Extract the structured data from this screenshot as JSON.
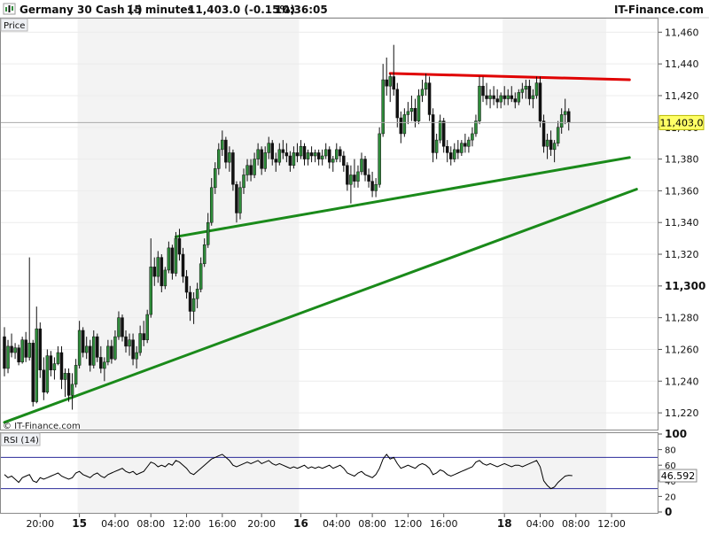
{
  "header": {
    "instrument": "Germany 30 Cash (-)",
    "timeframe": "15 minutes",
    "last_change": "11,403.0 (-0.15%)",
    "time": "10:36:05",
    "brand": "IT-Finance.com"
  },
  "price_panel": {
    "label": "Price",
    "watermark": "© IT-Finance.com"
  },
  "rsi_panel": {
    "label": "RSI (14)"
  },
  "colors": {
    "up_candle": "#2e8b3a",
    "down_candle": "#111111",
    "support_line": "#1a8a1a",
    "resistance_line": "#e00000",
    "rsi_line": "#000000",
    "rsi_bands": "#2b2b99",
    "price_tag_bg": "#ffff66"
  },
  "chart_data": [
    {
      "type": "candlestick",
      "y_ticks": [
        "11,220",
        "11,240",
        "11,260",
        "11,280",
        "11,300",
        "11,320",
        "11,340",
        "11,360",
        "11,380",
        "11,400",
        "11,420",
        "11,440",
        "11,460"
      ],
      "y_tick_values": [
        11220,
        11240,
        11260,
        11280,
        11300,
        11320,
        11340,
        11360,
        11380,
        11400,
        11420,
        11440,
        11460
      ],
      "y_major_tick": 11300,
      "ylim": [
        11210,
        11468
      ],
      "x_ticks": [
        "20:00",
        "15",
        "04:00",
        "08:00",
        "12:00",
        "16:00",
        "20:00",
        "16",
        "04:00",
        "08:00",
        "12:00",
        "16:00",
        "18",
        "04:00",
        "08:00",
        "12:00"
      ],
      "x_tick_index": [
        10,
        21,
        31,
        41,
        51,
        61,
        72,
        83,
        93,
        103,
        113,
        123,
        140,
        150,
        160,
        170
      ],
      "day_separators": [
        21,
        83,
        140
      ],
      "last_price": 11403.0,
      "last_price_label": "11,403,0",
      "candles": [
        [
          11268,
          11274,
          11243,
          11248
        ],
        [
          11248,
          11266,
          11245,
          11262
        ],
        [
          11262,
          11270,
          11255,
          11258
        ],
        [
          11258,
          11264,
          11254,
          11261
        ],
        [
          11261,
          11263,
          11250,
          11252
        ],
        [
          11252,
          11268,
          11251,
          11266
        ],
        [
          11266,
          11271,
          11252,
          11255
        ],
        [
          11255,
          11318,
          11253,
          11264
        ],
        [
          11264,
          11266,
          11224,
          11227
        ],
        [
          11227,
          11287,
          11226,
          11273
        ],
        [
          11273,
          11277,
          11242,
          11247
        ],
        [
          11247,
          11255,
          11228,
          11233
        ],
        [
          11233,
          11260,
          11232,
          11256
        ],
        [
          11256,
          11259,
          11243,
          11247
        ],
        [
          11247,
          11255,
          11241,
          11251
        ],
        [
          11251,
          11262,
          11250,
          11258
        ],
        [
          11258,
          11262,
          11235,
          11241
        ],
        [
          11241,
          11248,
          11230,
          11245
        ],
        [
          11245,
          11248,
          11227,
          11231
        ],
        [
          11231,
          11245,
          11222,
          11238
        ],
        [
          11238,
          11254,
          11236,
          11250
        ],
        [
          11250,
          11278,
          11248,
          11272
        ],
        [
          11272,
          11274,
          11255,
          11258
        ],
        [
          11258,
          11268,
          11254,
          11262
        ],
        [
          11262,
          11266,
          11246,
          11250
        ],
        [
          11250,
          11272,
          11248,
          11268
        ],
        [
          11268,
          11270,
          11252,
          11255
        ],
        [
          11255,
          11262,
          11245,
          11248
        ],
        [
          11248,
          11255,
          11240,
          11252
        ],
        [
          11252,
          11266,
          11250,
          11262
        ],
        [
          11262,
          11266,
          11251,
          11254
        ],
        [
          11254,
          11272,
          11253,
          11268
        ],
        [
          11268,
          11284,
          11266,
          11280
        ],
        [
          11280,
          11282,
          11265,
          11268
        ],
        [
          11268,
          11272,
          11258,
          11262
        ],
        [
          11262,
          11270,
          11256,
          11266
        ],
        [
          11266,
          11270,
          11250,
          11254
        ],
        [
          11254,
          11262,
          11248,
          11258
        ],
        [
          11258,
          11275,
          11256,
          11270
        ],
        [
          11270,
          11278,
          11262,
          11266
        ],
        [
          11266,
          11285,
          11264,
          11282
        ],
        [
          11282,
          11330,
          11280,
          11312
        ],
        [
          11312,
          11318,
          11300,
          11306
        ],
        [
          11306,
          11322,
          11302,
          11318
        ],
        [
          11318,
          11320,
          11296,
          11300
        ],
        [
          11300,
          11312,
          11298,
          11310
        ],
        [
          11310,
          11328,
          11308,
          11324
        ],
        [
          11324,
          11326,
          11304,
          11308
        ],
        [
          11308,
          11334,
          11306,
          11330
        ],
        [
          11330,
          11336,
          11316,
          11320
        ],
        [
          11320,
          11324,
          11302,
          11306
        ],
        [
          11306,
          11310,
          11292,
          11296
        ],
        [
          11296,
          11300,
          11278,
          11284
        ],
        [
          11284,
          11296,
          11276,
          11292
        ],
        [
          11292,
          11302,
          11286,
          11298
        ],
        [
          11298,
          11318,
          11296,
          11314
        ],
        [
          11314,
          11330,
          11312,
          11326
        ],
        [
          11326,
          11346,
          11324,
          11340
        ],
        [
          11340,
          11368,
          11338,
          11362
        ],
        [
          11362,
          11378,
          11358,
          11374
        ],
        [
          11374,
          11390,
          11370,
          11386
        ],
        [
          11386,
          11398,
          11382,
          11392
        ],
        [
          11392,
          11394,
          11374,
          11378
        ],
        [
          11378,
          11388,
          11372,
          11384
        ],
        [
          11384,
          11386,
          11360,
          11364
        ],
        [
          11364,
          11366,
          11340,
          11346
        ],
        [
          11346,
          11366,
          11342,
          11362
        ],
        [
          11362,
          11374,
          11358,
          11370
        ],
        [
          11370,
          11380,
          11366,
          11376
        ],
        [
          11376,
          11380,
          11366,
          11370
        ],
        [
          11370,
          11384,
          11368,
          11380
        ],
        [
          11380,
          11390,
          11376,
          11386
        ],
        [
          11386,
          11388,
          11370,
          11374
        ],
        [
          11374,
          11388,
          11372,
          11384
        ],
        [
          11384,
          11394,
          11380,
          11390
        ],
        [
          11390,
          11392,
          11376,
          11380
        ],
        [
          11380,
          11384,
          11372,
          11378
        ],
        [
          11378,
          11390,
          11376,
          11386
        ],
        [
          11386,
          11392,
          11380,
          11384
        ],
        [
          11384,
          11390,
          11378,
          11382
        ],
        [
          11382,
          11385,
          11372,
          11376
        ],
        [
          11376,
          11388,
          11374,
          11384
        ],
        [
          11384,
          11390,
          11378,
          11382
        ],
        [
          11382,
          11392,
          11380,
          11388
        ],
        [
          11388,
          11390,
          11376,
          11380
        ],
        [
          11380,
          11386,
          11376,
          11384
        ],
        [
          11384,
          11388,
          11378,
          11382
        ],
        [
          11382,
          11386,
          11378,
          11384
        ],
        [
          11384,
          11386,
          11376,
          11380
        ],
        [
          11380,
          11386,
          11376,
          11382
        ],
        [
          11382,
          11390,
          11380,
          11386
        ],
        [
          11386,
          11388,
          11374,
          11378
        ],
        [
          11378,
          11382,
          11372,
          11380
        ],
        [
          11380,
          11390,
          11378,
          11386
        ],
        [
          11386,
          11388,
          11378,
          11382
        ],
        [
          11382,
          11385,
          11372,
          11376
        ],
        [
          11376,
          11378,
          11360,
          11364
        ],
        [
          11364,
          11376,
          11352,
          11370
        ],
        [
          11370,
          11380,
          11362,
          11366
        ],
        [
          11366,
          11376,
          11362,
          11372
        ],
        [
          11372,
          11384,
          11370,
          11380
        ],
        [
          11380,
          11382,
          11366,
          11370
        ],
        [
          11370,
          11374,
          11362,
          11366
        ],
        [
          11366,
          11372,
          11356,
          11360
        ],
        [
          11360,
          11368,
          11356,
          11364
        ],
        [
          11364,
          11400,
          11362,
          11396
        ],
        [
          11396,
          11440,
          11394,
          11430
        ],
        [
          11430,
          11444,
          11420,
          11426
        ],
        [
          11426,
          11434,
          11416,
          11432
        ],
        [
          11432,
          11452,
          11420,
          11424
        ],
        [
          11424,
          11428,
          11400,
          11406
        ],
        [
          11406,
          11410,
          11390,
          11396
        ],
        [
          11396,
          11412,
          11394,
          11408
        ],
        [
          11408,
          11416,
          11402,
          11410
        ],
        [
          11410,
          11420,
          11404,
          11412
        ],
        [
          11412,
          11418,
          11400,
          11404
        ],
        [
          11404,
          11424,
          11402,
          11420
        ],
        [
          11420,
          11430,
          11416,
          11424
        ],
        [
          11424,
          11434,
          11420,
          11428
        ],
        [
          11428,
          11432,
          11404,
          11408
        ],
        [
          11408,
          11412,
          11378,
          11384
        ],
        [
          11384,
          11396,
          11380,
          11392
        ],
        [
          11392,
          11408,
          11390,
          11404
        ],
        [
          11404,
          11406,
          11384,
          11388
        ],
        [
          11388,
          11392,
          11378,
          11384
        ],
        [
          11384,
          11388,
          11376,
          11380
        ],
        [
          11380,
          11390,
          11378,
          11386
        ],
        [
          11386,
          11392,
          11380,
          11384
        ],
        [
          11384,
          11392,
          11382,
          11390
        ],
        [
          11390,
          11396,
          11384,
          11388
        ],
        [
          11388,
          11394,
          11384,
          11392
        ],
        [
          11392,
          11400,
          11388,
          11396
        ],
        [
          11396,
          11408,
          11394,
          11404
        ],
        [
          11404,
          11432,
          11402,
          11426
        ],
        [
          11426,
          11432,
          11416,
          11420
        ],
        [
          11420,
          11428,
          11414,
          11418
        ],
        [
          11418,
          11424,
          11412,
          11420
        ],
        [
          11420,
          11426,
          11414,
          11418
        ],
        [
          11418,
          11424,
          11412,
          11416
        ],
        [
          11416,
          11422,
          11412,
          11420
        ],
        [
          11420,
          11426,
          11414,
          11418
        ],
        [
          11418,
          11424,
          11414,
          11420
        ],
        [
          11420,
          11426,
          11416,
          11418
        ],
        [
          11418,
          11422,
          11412,
          11416
        ],
        [
          11416,
          11424,
          11414,
          11422
        ],
        [
          11422,
          11428,
          11418,
          11424
        ],
        [
          11424,
          11430,
          11418,
          11426
        ],
        [
          11426,
          11430,
          11414,
          11418
        ],
        [
          11418,
          11424,
          11412,
          11420
        ],
        [
          11420,
          11432,
          11418,
          11428
        ],
        [
          11428,
          11432,
          11400,
          11404
        ],
        [
          11404,
          11408,
          11384,
          11388
        ],
        [
          11388,
          11396,
          11380,
          11392
        ],
        [
          11392,
          11398,
          11382,
          11386
        ],
        [
          11386,
          11392,
          11378,
          11390
        ],
        [
          11390,
          11404,
          11388,
          11400
        ],
        [
          11400,
          11412,
          11396,
          11408
        ],
        [
          11408,
          11418,
          11402,
          11410
        ],
        [
          11410,
          11412,
          11398,
          11403
        ]
      ],
      "trendlines": [
        {
          "role": "lower-support",
          "from": [
            0,
            11214
          ],
          "to": [
            177,
            11361
          ]
        },
        {
          "role": "upper-support",
          "from": [
            48,
            11331
          ],
          "to": [
            175,
            11381
          ]
        },
        {
          "role": "resistance",
          "from": [
            108,
            11434
          ],
          "to": [
            175,
            11430
          ]
        }
      ]
    },
    {
      "type": "line",
      "ylim": [
        0,
        100
      ],
      "y_ticks": [
        "100",
        "80",
        "60",
        "40",
        "20",
        "0"
      ],
      "y_tick_values": [
        100,
        80,
        60,
        40,
        20,
        0
      ],
      "bands": [
        70,
        30
      ],
      "last_value_label": "46.592",
      "values": [
        48,
        44,
        46,
        42,
        38,
        44,
        46,
        48,
        40,
        38,
        44,
        42,
        44,
        46,
        48,
        50,
        46,
        44,
        42,
        44,
        50,
        52,
        48,
        46,
        44,
        48,
        50,
        46,
        44,
        48,
        50,
        52,
        54,
        56,
        52,
        50,
        52,
        48,
        50,
        52,
        58,
        64,
        62,
        58,
        60,
        58,
        62,
        60,
        66,
        64,
        60,
        56,
        50,
        48,
        52,
        56,
        60,
        64,
        68,
        70,
        72,
        74,
        70,
        66,
        60,
        58,
        60,
        62,
        64,
        62,
        64,
        66,
        62,
        64,
        66,
        62,
        60,
        62,
        60,
        58,
        56,
        58,
        56,
        58,
        60,
        56,
        58,
        56,
        58,
        56,
        58,
        60,
        56,
        58,
        60,
        56,
        50,
        48,
        46,
        50,
        52,
        48,
        46,
        44,
        48,
        56,
        68,
        74,
        68,
        70,
        62,
        56,
        58,
        60,
        58,
        56,
        60,
        62,
        60,
        56,
        48,
        50,
        54,
        52,
        48,
        46,
        48,
        50,
        52,
        54,
        56,
        58,
        64,
        66,
        62,
        60,
        62,
        60,
        58,
        60,
        62,
        60,
        58,
        60,
        60,
        58,
        60,
        62,
        64,
        66,
        58,
        40,
        34,
        30,
        32,
        38,
        42,
        46,
        47,
        46.592
      ]
    }
  ]
}
